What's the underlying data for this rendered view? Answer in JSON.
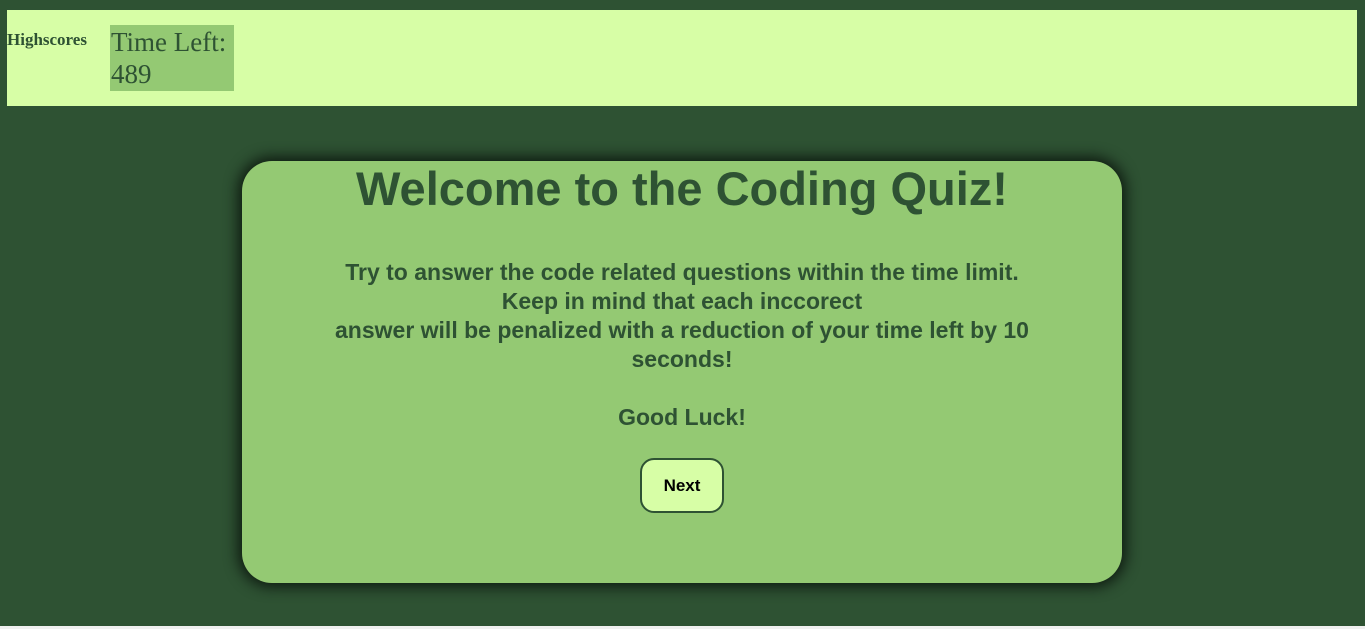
{
  "header": {
    "highscores_label": "Highscores",
    "timer_label": "Time Left:",
    "timer_value": "489"
  },
  "card": {
    "title": "Welcome to the Coding Quiz!",
    "instructions_line1": "Try to answer the code related questions within the time limit.",
    "instructions_line2": "Keep in mind that each inccorect",
    "instructions_line3": "answer will be penalized with a reduction of your time left by 10 seconds!",
    "good_luck": "Good Luck!",
    "next_label": "Next"
  },
  "colors": {
    "background": "#2e5233",
    "header": "#d7fea6",
    "card": "#94c973",
    "text": "#2e5233"
  }
}
